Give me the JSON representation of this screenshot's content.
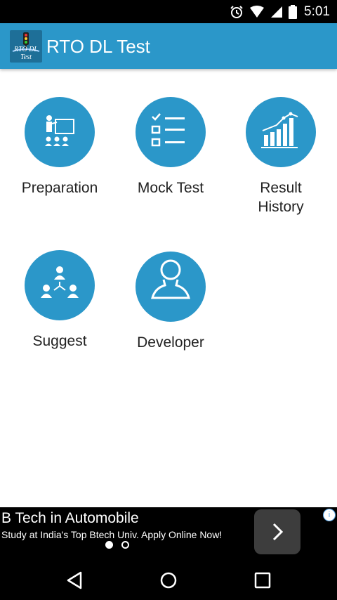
{
  "status_bar": {
    "time": "5:01",
    "icons": [
      "alarm-icon",
      "wifi-icon",
      "signal-icon",
      "battery-icon"
    ]
  },
  "app_bar": {
    "logo_text": "RTO DL Test",
    "title": "RTO DL Test",
    "color": "#2b97c9"
  },
  "menu": {
    "preparation": {
      "label": "Preparation",
      "icon": "presentation-icon"
    },
    "mock_test": {
      "label": "Mock Test",
      "icon": "checklist-icon"
    },
    "result_history": {
      "label_line1": "Result",
      "label_line2": "History",
      "icon": "bar-chart-icon"
    },
    "suggest": {
      "label": "Suggest",
      "icon": "share-network-icon"
    },
    "developer": {
      "label": "Developer",
      "icon": "person-silhouette-icon"
    }
  },
  "ad": {
    "title": "B Tech in Automobile",
    "subtitle": "Study at India's Top Btech Univ. Apply Online Now!",
    "info_glyph": "i",
    "pages_total": 2,
    "page_active": 1
  },
  "nav_bar": {
    "icons": [
      "back-icon",
      "home-icon",
      "recents-icon"
    ]
  }
}
